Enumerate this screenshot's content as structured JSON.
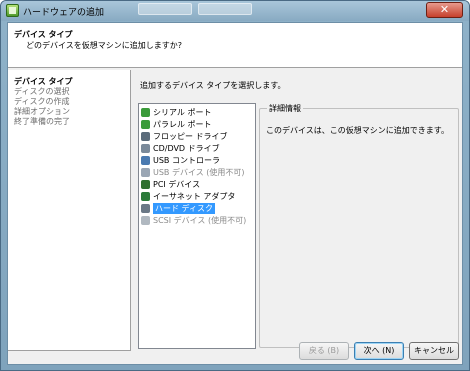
{
  "window": {
    "title": "ハードウェアの追加",
    "close_label": "✕"
  },
  "header": {
    "title": "デバイス タイプ",
    "subtitle": "どのデバイスを仮想マシンに追加しますか?"
  },
  "steps": [
    {
      "label": "デバイス タイプ",
      "active": true
    },
    {
      "label": "ディスクの選択",
      "active": false
    },
    {
      "label": "ディスクの作成",
      "active": false
    },
    {
      "label": "詳細オプション",
      "active": false
    },
    {
      "label": "終了準備の完了",
      "active": false
    }
  ],
  "main": {
    "prompt": "追加するデバイス タイプを選択します。"
  },
  "devices": [
    {
      "label": "シリアル ポート",
      "icon": "serial-port-icon",
      "color": "#3a9b3a",
      "enabled": true,
      "selected": false
    },
    {
      "label": "パラレル ポート",
      "icon": "parallel-port-icon",
      "color": "#3a9b3a",
      "enabled": true,
      "selected": false
    },
    {
      "label": "フロッピー ドライブ",
      "icon": "floppy-drive-icon",
      "color": "#5a6b7a",
      "enabled": true,
      "selected": false
    },
    {
      "label": "CD/DVD ドライブ",
      "icon": "cd-dvd-drive-icon",
      "color": "#7a8a9a",
      "enabled": true,
      "selected": false
    },
    {
      "label": "USB コントローラ",
      "icon": "usb-controller-icon",
      "color": "#4a7ab0",
      "enabled": true,
      "selected": false
    },
    {
      "label": "USB デバイス (使用不可)",
      "icon": "usb-device-icon",
      "color": "#9aa6b4",
      "enabled": false,
      "selected": false
    },
    {
      "label": "PCI デバイス",
      "icon": "pci-device-icon",
      "color": "#2f6f2f",
      "enabled": true,
      "selected": false
    },
    {
      "label": "イーサネット アダプタ",
      "icon": "ethernet-adapter-icon",
      "color": "#2b7a3a",
      "enabled": true,
      "selected": false
    },
    {
      "label": "ハード ディスク",
      "icon": "hard-disk-icon",
      "color": "#6a7886",
      "enabled": true,
      "selected": true
    },
    {
      "label": "SCSI デバイス (使用不可)",
      "icon": "scsi-device-icon",
      "color": "#b0b8c0",
      "enabled": false,
      "selected": false
    }
  ],
  "details": {
    "legend": "詳細情報",
    "text": "このデバイスは、この仮想マシンに追加できます。"
  },
  "buttons": {
    "back": "戻る (B)",
    "next": "次へ (N)",
    "cancel": "キャンセル"
  }
}
